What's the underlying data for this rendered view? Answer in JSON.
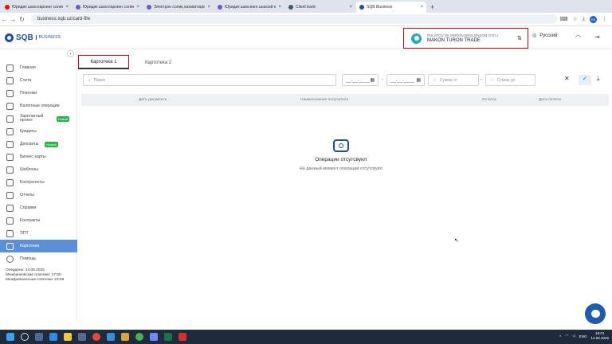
{
  "browser": {
    "tabs": [
      {
        "title": "Юридик шахсларнинг солиқ т",
        "favicon_color": "#ff0000"
      },
      {
        "title": "Юридик шахсларнинг солиқ",
        "favicon_color": "#6a5acd"
      },
      {
        "title": "Электрон солиқ хизматлари",
        "favicon_color": "#6a5acd"
      },
      {
        "title": "Юридик шахснинг шахсий кабі",
        "favicon_color": "#6a5acd"
      },
      {
        "title": "Client bank",
        "favicon_color": "#4a5566"
      },
      {
        "title": "SQB Business",
        "favicon_color": "#1f4f9e"
      }
    ],
    "url": "business.sqb.uz/card-file",
    "profile_initials": "RS"
  },
  "header": {
    "logo_text": "SQB",
    "logo_sub": "BUSINESS",
    "user_name": "PULATOV ISLOMXON MAVLONXON O'G'LI",
    "company_name": "MAKON TURON TRADE",
    "language": "Русский"
  },
  "sidebar": {
    "items": [
      {
        "label": "Главная",
        "icon": "home-icon"
      },
      {
        "label": "Счета",
        "icon": "accounts-icon"
      },
      {
        "label": "Платежи",
        "icon": "payments-icon"
      },
      {
        "label": "Валютные операции",
        "icon": "currency-icon"
      },
      {
        "label": "Зарплатный проект",
        "icon": "salary-icon",
        "badge": "Новый"
      },
      {
        "label": "Кредиты",
        "icon": "credit-icon"
      },
      {
        "label": "Депозиты",
        "icon": "deposit-icon",
        "badge": "Новый"
      },
      {
        "label": "Бизнес карты",
        "icon": "card-icon"
      },
      {
        "label": "Шаблоны",
        "icon": "templates-icon"
      },
      {
        "label": "Контрагенты",
        "icon": "contractors-icon"
      },
      {
        "label": "Отчеты",
        "icon": "reports-icon"
      },
      {
        "label": "Справки",
        "icon": "certificates-icon"
      },
      {
        "label": "Контракты",
        "icon": "contracts-icon"
      },
      {
        "label": "ЭПТ",
        "icon": "ept-icon"
      },
      {
        "label": "Картотека",
        "icon": "folder-icon",
        "active": true
      },
      {
        "label": "Помощь",
        "icon": "help-icon"
      }
    ],
    "deadlines": [
      "Опердень: 14.08.2025",
      "Межбанковские платежи: 17:00",
      "Межфилиальные платежи: 23:59"
    ]
  },
  "main": {
    "tabs": [
      "Картотека 1",
      "Картотека 2"
    ],
    "search_placeholder": "Поиск",
    "date_from": "__.__.____",
    "date_to": "__.__.____",
    "amount_from": "Сумма от",
    "amount_to": "Сумма до",
    "columns": [
      "Дата документа",
      "Наименование получателя",
      "Остаток",
      "Дата оплаты"
    ],
    "empty_title": "Операции отсутсвуют",
    "empty_subtitle": "На данный момент операции отсутсвуют"
  },
  "taskbar": {
    "lang": "ENG",
    "time": "16:01",
    "date": "14.08.2025"
  }
}
